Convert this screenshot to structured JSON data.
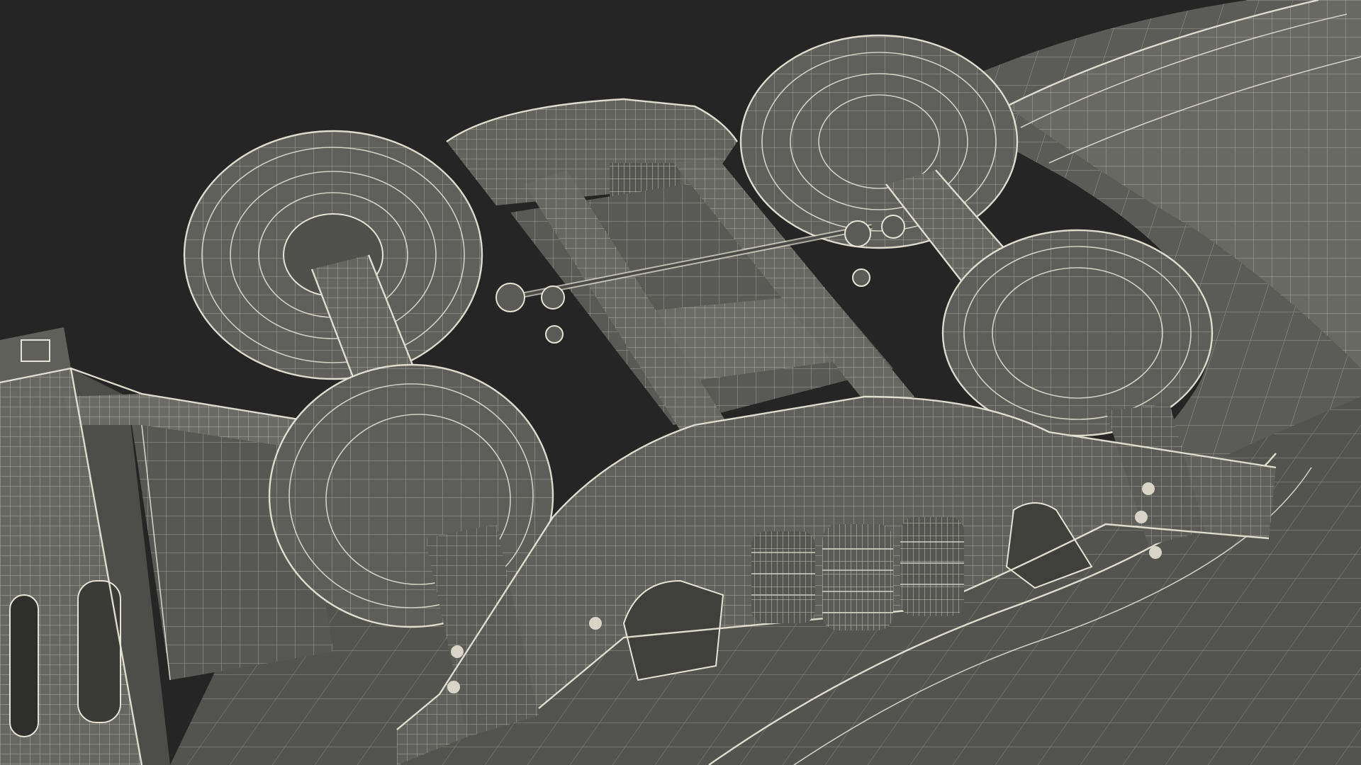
{
  "scene": {
    "description_visible_text": "",
    "background_color": "#252525",
    "surface_color": "#5e5f5a",
    "surface_dark": "#474843",
    "surface_light": "#6b6c66",
    "wire_color": "#e6e3d6"
  }
}
